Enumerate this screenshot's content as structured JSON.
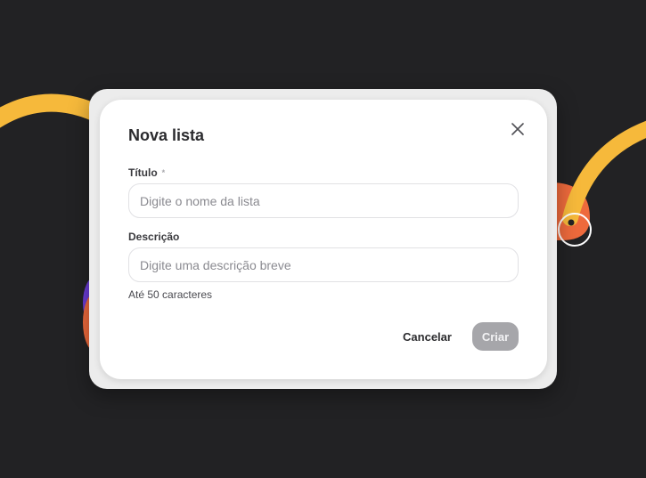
{
  "dialog": {
    "title": "Nova lista",
    "close_icon": "close-icon",
    "fields": {
      "title": {
        "label": "Título",
        "required_marker": "*",
        "value": "",
        "placeholder": "Digite o nome da lista"
      },
      "description": {
        "label": "Descrição",
        "value": "",
        "placeholder": "Digite uma descrição breve",
        "hint": "Até 50 caracteres"
      }
    },
    "buttons": {
      "cancel": "Cancelar",
      "create": "Criar"
    }
  },
  "colors": {
    "background": "#222224",
    "accent_yellow": "#F6B93B",
    "accent_orange": "#EE6A3C",
    "accent_purple": "#6A3CD6",
    "button_disabled": "#A6A6AA"
  }
}
